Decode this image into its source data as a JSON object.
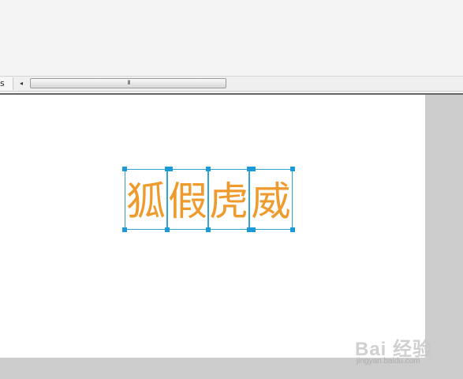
{
  "scrollbar": {
    "tab_stub_text": "s",
    "left_arrow": "◂",
    "thumb_grip": "lll"
  },
  "text_frames": [
    {
      "char": "狐"
    },
    {
      "char": "假"
    },
    {
      "char": "虎"
    },
    {
      "char": "威"
    }
  ],
  "watermark": {
    "brand": "Bai 经验",
    "url": "jingyan.baidu.com"
  },
  "colors": {
    "text": "#ee9a2c",
    "frame_border": "#2fa5cf",
    "handle": "#1a9ad6",
    "pasteboard": "#cdcdcd",
    "page": "#ffffff"
  }
}
